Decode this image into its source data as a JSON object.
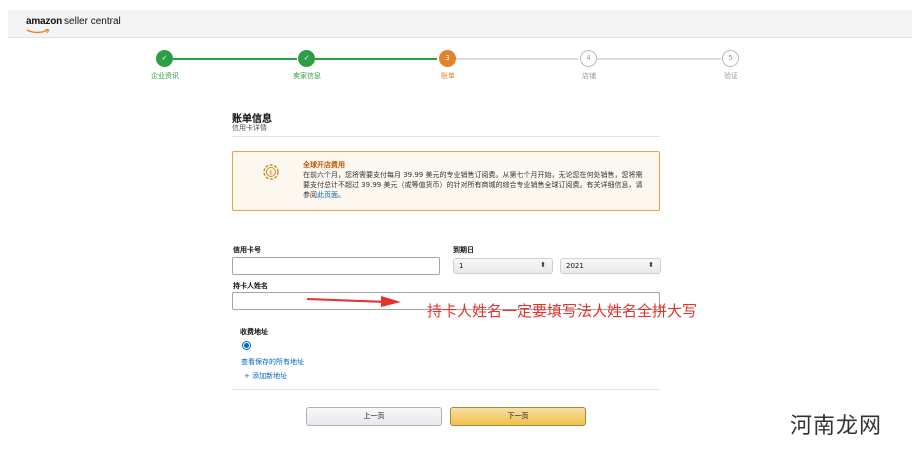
{
  "header": {
    "logo_brand": "amazon",
    "logo_product": "seller central"
  },
  "steps": [
    {
      "label": "企业资讯",
      "state": "done",
      "marker": "✓"
    },
    {
      "label": "卖家信息",
      "state": "done",
      "marker": "✓"
    },
    {
      "label": "账单",
      "state": "current",
      "marker": "3"
    },
    {
      "label": "店铺",
      "state": "todo",
      "marker": "4"
    },
    {
      "label": "验证",
      "state": "todo",
      "marker": "5"
    }
  ],
  "section": {
    "title": "账单信息",
    "subtitle": "信用卡详情"
  },
  "notice": {
    "title": "全球开店费用",
    "body": "在前六个月，您将需要支付每月 39.99 美元的专业销售订阅费。从第七个月开始，无论您在何处销售，您将需要支付总计不超过 39.99 美元（或等值货币）的针对所有商城的综合专业销售全球订阅费。有关详细信息，请参阅",
    "link": "此页面",
    "end": "。"
  },
  "fields": {
    "card_number_label": "信用卡号",
    "expiry_label": "到期日",
    "expiry_month": "1",
    "expiry_year": "2021",
    "cardholder_label": "持卡人姓名"
  },
  "annotation": "持卡人姓名一定要填写法人姓名全拼大写",
  "address": {
    "label": "收费地址",
    "view_all": "查看保存的所有地址",
    "add_new": "+ 添加新地址"
  },
  "buttons": {
    "prev": "上一页",
    "next": "下一页"
  },
  "watermark": "河南龙网",
  "colors": {
    "done": "#2e9e45",
    "current": "#e4812b",
    "annotation": "#e5322d",
    "link": "#0066c0"
  }
}
